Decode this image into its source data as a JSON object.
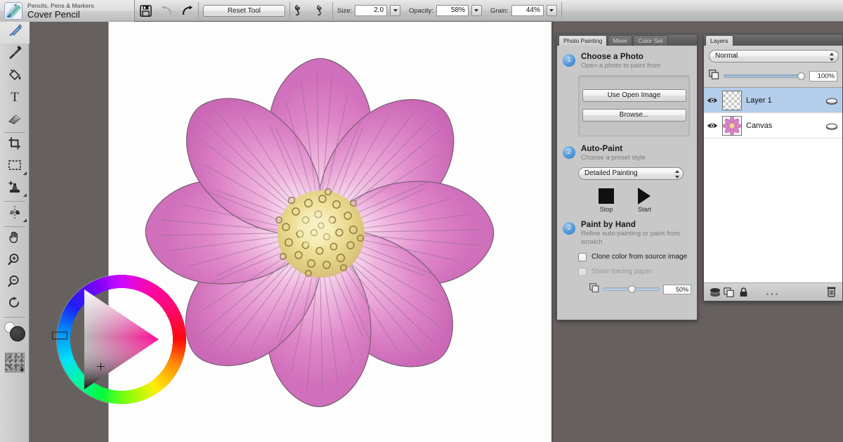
{
  "app": {
    "background_color": "#66615f",
    "accent_color": "#3e8ed6"
  },
  "toolbar": {
    "tool_category": "Pencils, Pens & Markers",
    "tool_name": "Cover Pencil",
    "tool_icon": "pencils-pens-markers-icon",
    "save_icon": "save-disk-icon",
    "undo_icon": "undo-arrow-icon",
    "redo_icon": "redo-arrow-icon",
    "reset_label": "Reset Tool",
    "stroke_preview_1_icon": "brush-stroke-preview-icon",
    "stroke_preview_2_icon": "brush-stroke-preview-icon",
    "params": [
      {
        "label": "Size:",
        "value": "2.0",
        "name": "size"
      },
      {
        "label": "Opacity:",
        "value": "58%",
        "name": "opacity"
      },
      {
        "label": "Grain:",
        "value": "44%",
        "name": "grain"
      }
    ]
  },
  "toolbox": {
    "tools": [
      {
        "name": "brush-tool",
        "icon": "paintbrush-icon",
        "active": true
      },
      {
        "name": "dropper-tool",
        "icon": "eyedropper-icon",
        "active": false
      },
      {
        "name": "paint-bucket-tool",
        "icon": "paint-bucket-icon",
        "active": false
      },
      {
        "name": "text-tool",
        "icon": "text-t-icon",
        "active": false
      },
      {
        "name": "eraser-tool",
        "icon": "eraser-icon",
        "active": false
      },
      {
        "name": "crop-tool",
        "icon": "crop-icon",
        "active": false
      },
      {
        "name": "rectangular-selection-tool",
        "icon": "marquee-select-icon",
        "active": false
      },
      {
        "name": "cloner-tool",
        "icon": "rubber-stamp-icon",
        "active": false
      },
      {
        "name": "mirror-painting-tool",
        "icon": "mirror-painting-icon",
        "active": false
      },
      {
        "name": "grabber-tool",
        "icon": "hand-icon",
        "active": false
      },
      {
        "name": "magnifier-in-tool",
        "icon": "zoom-in-icon",
        "active": false
      },
      {
        "name": "magnifier-out-tool",
        "icon": "zoom-out-icon",
        "active": false
      },
      {
        "name": "rotate-page-tool",
        "icon": "rotate-icon",
        "active": false
      }
    ],
    "swatches": {
      "primary_color": "#2a2a2a",
      "secondary_color": "#f0f0f0",
      "pattern_icon": "pattern-swatch-icon"
    }
  },
  "color_wheel": {
    "name": "color-wheel",
    "selected_hue": "#ff0099",
    "hue_marker_angle_deg": 180,
    "triangle_cursor": "saturation-value-cursor"
  },
  "canvas": {
    "name": "painting-canvas",
    "artwork": "pink-cosmos-flower",
    "background": "#fdfdfd",
    "petal_color": "#e07fc8",
    "petal_light": "#f3c3e6",
    "center_color": "#e6d789"
  },
  "photo_painting_panel": {
    "tabs": [
      {
        "label": "Photo Painting",
        "active": true,
        "name": "tab-photo-painting"
      },
      {
        "label": "Mixer",
        "active": false,
        "name": "tab-mixer"
      },
      {
        "label": "Color Set",
        "active": false,
        "name": "tab-color-set"
      }
    ],
    "step1": {
      "number": "1",
      "title": "Choose a Photo",
      "subtitle": "Open a photo to paint from",
      "use_open_image_label": "Use Open Image",
      "browse_label": "Browse..."
    },
    "step2": {
      "number": "2",
      "title": "Auto-Paint",
      "subtitle": "Choose a preset style",
      "preset_value": "Detailed Painting",
      "stop_label": "Stop",
      "start_label": "Start"
    },
    "step3": {
      "number": "3",
      "title": "Paint by Hand",
      "subtitle": "Refine auto-painting or paint from scratch",
      "clone_color_label": "Clone color from source image",
      "clone_color_checked": false,
      "tracing_paper_label": "Show tracing paper",
      "tracing_paper_checked": false,
      "tracing_paper_disabled": true,
      "opacity_value": "50%"
    }
  },
  "layers_panel": {
    "tab_label": "Layers",
    "blend_mode": "Normal",
    "opacity_value": "100%",
    "layers": [
      {
        "name": "Layer 1",
        "selected": true,
        "visible": true,
        "thumb": "transparent-checker"
      },
      {
        "name": "Canvas",
        "selected": false,
        "visible": true,
        "thumb": "flower-thumbnail"
      }
    ],
    "footer": {
      "dynamic_plugins_icon": "dynamic-plugins-icon",
      "new_layer_icon": "new-layer-icon",
      "lock_icon": "lock-icon",
      "delete_icon": "trash-icon",
      "grip_dots": "•••"
    }
  }
}
